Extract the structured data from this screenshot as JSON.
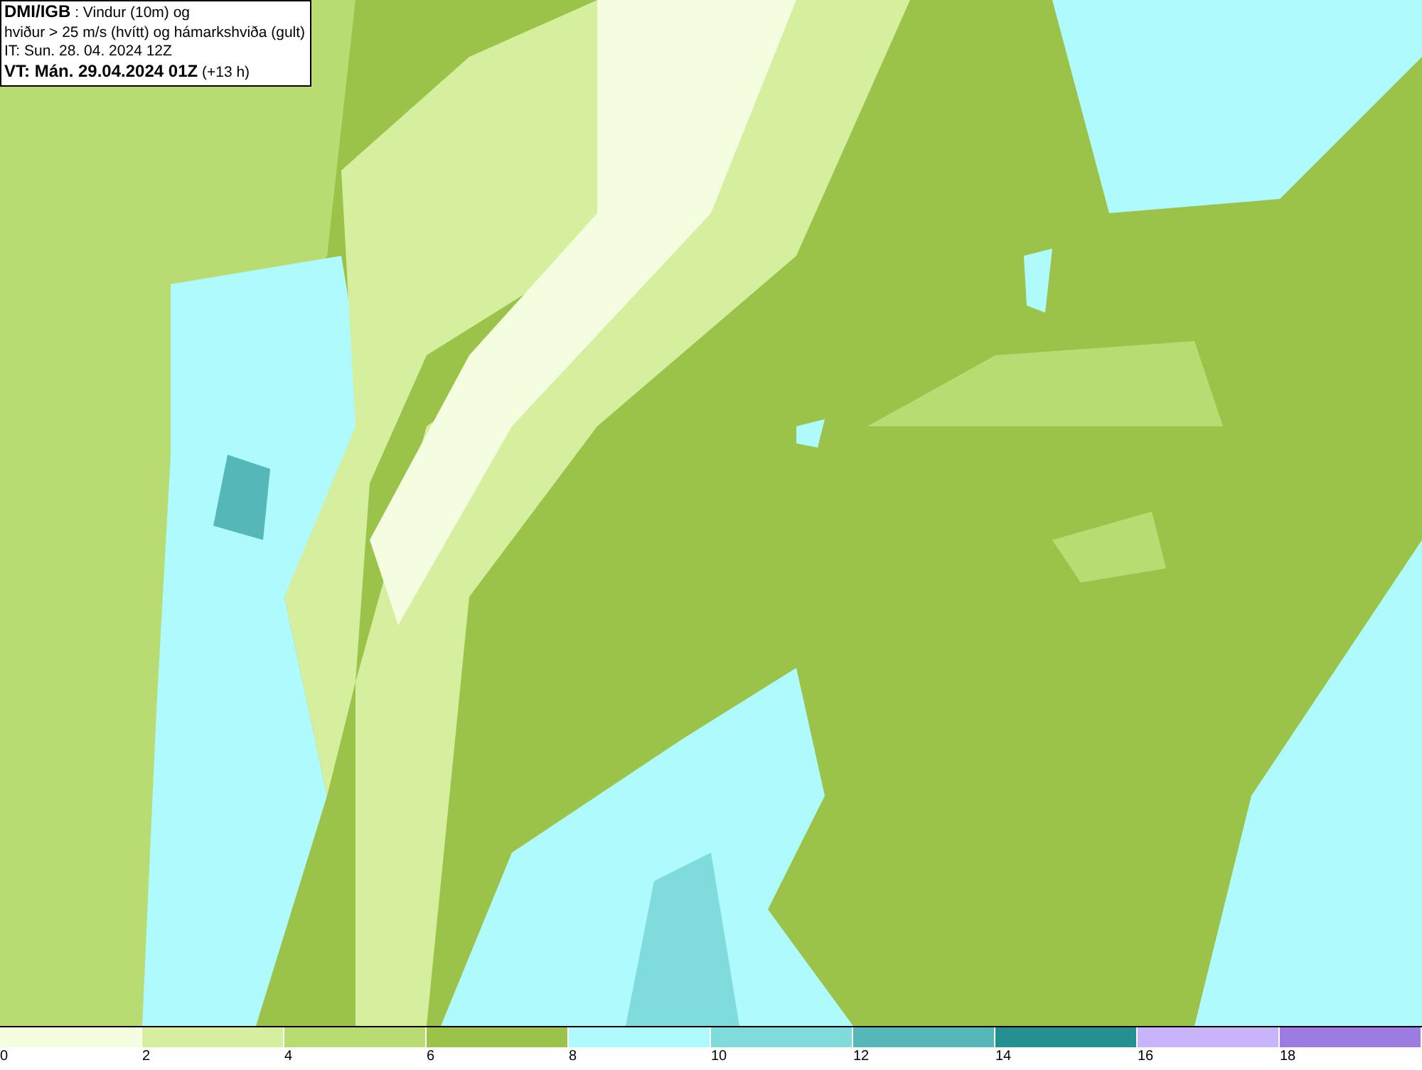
{
  "header": {
    "lines": [
      "**DMI/IGB** : Vindur (10m) og",
      "hviður > 25 m/s (hvítt) og hámarkshviða (gult)",
      "IT: Sun. 28. 04. 2024 12Z",
      "**VT: Mán. 29.04.2024 01Z** (+13 h)"
    ]
  },
  "legend": {
    "bins": [
      {
        "color": "#f5fde0",
        "label": "0"
      },
      {
        "color": "#d5ef9e",
        "label": "2"
      },
      {
        "color": "#b8dc72",
        "label": "4"
      },
      {
        "color": "#9bc34a",
        "label": "6"
      },
      {
        "color": "#aefafd",
        "label": "8"
      },
      {
        "color": "#80dcdc",
        "label": "10"
      },
      {
        "color": "#55b8b8",
        "label": "12"
      },
      {
        "color": "#259090",
        "label": "14"
      },
      {
        "color": "#c8b4f8",
        "label": "16"
      },
      {
        "color": "#9c7ce0",
        "label": "18"
      }
    ]
  }
}
